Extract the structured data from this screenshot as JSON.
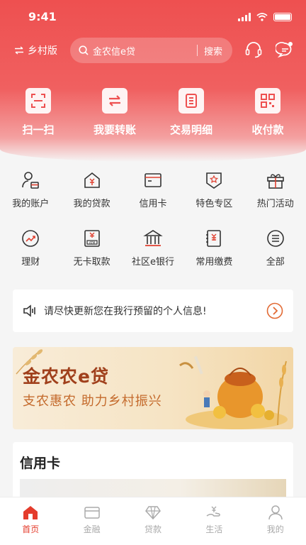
{
  "status": {
    "time": "9:41"
  },
  "header": {
    "village_label": "乡村版",
    "search_placeholder": "金农信e贷",
    "search_button": "搜索",
    "icons": [
      "customer-service-icon",
      "message-icon"
    ]
  },
  "quick_actions": [
    {
      "label": "扫一扫",
      "icon": "scan-icon"
    },
    {
      "label": "我要转账",
      "icon": "transfer-icon"
    },
    {
      "label": "交易明细",
      "icon": "transaction-detail-icon"
    },
    {
      "label": "收付款",
      "icon": "qr-code-icon"
    }
  ],
  "services": [
    {
      "label": "我的账户",
      "icon": "account-icon"
    },
    {
      "label": "我的贷款",
      "icon": "loan-icon"
    },
    {
      "label": "信用卡",
      "icon": "credit-card-icon"
    },
    {
      "label": "特色专区",
      "icon": "special-zone-icon"
    },
    {
      "label": "热门活动",
      "icon": "gift-icon"
    },
    {
      "label": "理财",
      "icon": "wealth-icon"
    },
    {
      "label": "无卡取款",
      "icon": "atm-icon"
    },
    {
      "label": "社区e银行",
      "icon": "bank-icon"
    },
    {
      "label": "常用缴费",
      "icon": "bill-icon"
    },
    {
      "label": "全部",
      "icon": "all-menu-icon"
    }
  ],
  "notice": {
    "text": "请尽快更新您在我行预留的个人信息!"
  },
  "banner": {
    "title": "金农农e贷",
    "subtitle": "支农惠农 助力乡村振兴"
  },
  "credit_card_section": {
    "title": "信用卡"
  },
  "tabbar": [
    {
      "label": "首页",
      "icon": "home-icon",
      "active": true
    },
    {
      "label": "金融",
      "icon": "wallet-icon",
      "active": false
    },
    {
      "label": "贷款",
      "icon": "diamond-icon",
      "active": false
    },
    {
      "label": "生活",
      "icon": "life-icon",
      "active": false
    },
    {
      "label": "我的",
      "icon": "user-icon",
      "active": false
    }
  ],
  "colors": {
    "brand_red": "#ee5050",
    "active_tab": "#e43c2c",
    "banner_title": "#a0401c"
  }
}
